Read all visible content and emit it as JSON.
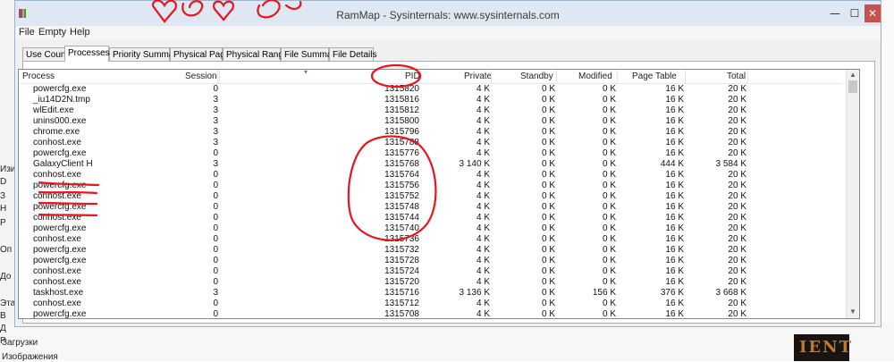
{
  "window": {
    "title": "RamMap - Sysinternals: www.sysinternals.com",
    "min_glyph": "—",
    "max_glyph": "☐",
    "close_glyph": "✕",
    "icon_colors": [
      "#e3342f",
      "#2d6cdf",
      "#f59e0b",
      "#22a34a"
    ]
  },
  "menu": {
    "items": [
      "File",
      "Empty",
      "Help"
    ]
  },
  "tabs": {
    "items": [
      "Use Counts",
      "Processes",
      "Priority Summary",
      "Physical Pages",
      "Physical Ranges",
      "File Summary",
      "File Details"
    ],
    "active": "Processes"
  },
  "table": {
    "columns": [
      "Process",
      "Session",
      "PID",
      "Private",
      "Standby",
      "Modified",
      "Page Table",
      "Total"
    ],
    "rows": [
      [
        "powercfg.exe",
        "0",
        "1315820",
        "4 K",
        "0 K",
        "0 K",
        "16 K",
        "20 K"
      ],
      [
        "_iu14D2N.tmp",
        "3",
        "1315816",
        "4 K",
        "0 K",
        "0 K",
        "16 K",
        "20 K"
      ],
      [
        "wlEdit.exe",
        "3",
        "1315812",
        "4 K",
        "0 K",
        "0 K",
        "16 K",
        "20 K"
      ],
      [
        "unins000.exe",
        "3",
        "1315800",
        "4 K",
        "0 K",
        "0 K",
        "16 K",
        "20 K"
      ],
      [
        "chrome.exe",
        "3",
        "1315796",
        "4 K",
        "0 K",
        "0 K",
        "16 K",
        "20 K"
      ],
      [
        "conhost.exe",
        "3",
        "1315788",
        "4 K",
        "0 K",
        "0 K",
        "16 K",
        "20 K"
      ],
      [
        "powercfg.exe",
        "0",
        "1315776",
        "4 K",
        "0 K",
        "0 K",
        "16 K",
        "20 K"
      ],
      [
        "GalaxyClient H",
        "3",
        "1315768",
        "3 140 K",
        "0 K",
        "0 K",
        "444 K",
        "3 584 K"
      ],
      [
        "conhost.exe",
        "0",
        "1315764",
        "4 K",
        "0 K",
        "0 K",
        "16 K",
        "20 K"
      ],
      [
        "powercfg.exe",
        "0",
        "1315756",
        "4 K",
        "0 K",
        "0 K",
        "16 K",
        "20 K"
      ],
      [
        "conhost.exe",
        "0",
        "1315752",
        "4 K",
        "0 K",
        "0 K",
        "16 K",
        "20 K"
      ],
      [
        "powercfg.exe",
        "0",
        "1315748",
        "4 K",
        "0 K",
        "0 K",
        "16 K",
        "20 K"
      ],
      [
        "conhost.exe",
        "0",
        "1315744",
        "4 K",
        "0 K",
        "0 K",
        "16 K",
        "20 K"
      ],
      [
        "powercfg.exe",
        "0",
        "1315740",
        "4 K",
        "0 K",
        "0 K",
        "16 K",
        "20 K"
      ],
      [
        "conhost.exe",
        "0",
        "1315736",
        "4 K",
        "0 K",
        "0 K",
        "16 K",
        "20 K"
      ],
      [
        "powercfg.exe",
        "0",
        "1315732",
        "4 K",
        "0 K",
        "0 K",
        "16 K",
        "20 K"
      ],
      [
        "powercfg.exe",
        "0",
        "1315728",
        "4 K",
        "0 K",
        "0 K",
        "16 K",
        "20 K"
      ],
      [
        "conhost.exe",
        "0",
        "1315724",
        "4 K",
        "0 K",
        "0 K",
        "16 K",
        "20 K"
      ],
      [
        "conhost.exe",
        "0",
        "1315720",
        "4 K",
        "0 K",
        "0 K",
        "16 K",
        "20 K"
      ],
      [
        "taskhost.exe",
        "3",
        "1315716",
        "3 136 K",
        "0 K",
        "156 K",
        "376 K",
        "3 668 K"
      ],
      [
        "conhost.exe",
        "0",
        "1315712",
        "4 K",
        "0 K",
        "0 K",
        "16 K",
        "20 K"
      ],
      [
        "powercfg.exe",
        "0",
        "1315708",
        "4 K",
        "0 K",
        "0 K",
        "16 K",
        "20 K"
      ]
    ]
  },
  "background": {
    "left_items": [
      "Изи",
      "D",
      "З",
      "Н",
      "Р",
      "Оп",
      "До",
      "Эта",
      "В",
      "Д",
      "Р",
      "Загрузки",
      "Изображения"
    ],
    "right_image_text": "IENT"
  },
  "annotations": {
    "ink_color": "#e8141e"
  }
}
